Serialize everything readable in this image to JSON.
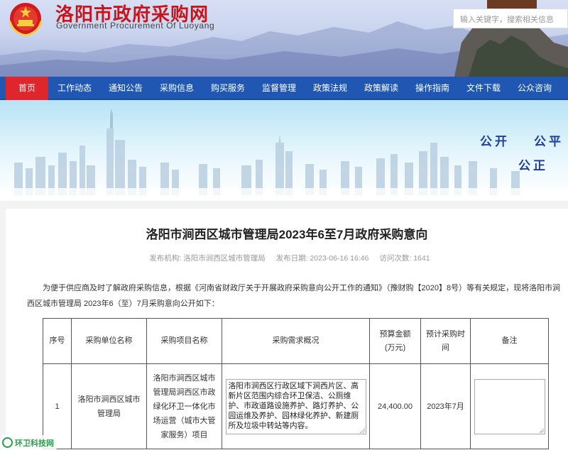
{
  "header": {
    "title": "洛阳市政府采购网",
    "subtitle": "Government Procurement Of Luoyang",
    "search_placeholder": "输入关键字，搜索相关信息"
  },
  "nav": {
    "items": [
      {
        "label": "首页",
        "active": true
      },
      {
        "label": "工作动态"
      },
      {
        "label": "通知公告"
      },
      {
        "label": "采购信息"
      },
      {
        "label": "购买服务"
      },
      {
        "label": "监督管理"
      },
      {
        "label": "政策法规"
      },
      {
        "label": "政策解读"
      },
      {
        "label": "操作指南"
      },
      {
        "label": "文件下载"
      },
      {
        "label": "公众咨询"
      }
    ]
  },
  "banner": {
    "slogan1": "公开",
    "slogan2": "公平",
    "slogan3": "公正"
  },
  "article": {
    "title": "洛阳市涧西区城市管理局2023年6至7月政府采购意向",
    "publisher_label": "发布机构:",
    "publisher": "洛阳市涧西区城市管理局",
    "date_label": "发布日期:",
    "date": "2023-06-16 16:46",
    "visits_label": "访问次数:",
    "visits": "1641",
    "intro_line1": "为便于供应商及时了解政府采购信息，根据《河南省财政厅关于开展政府采购意向公开工作的通知》（豫财购【2020】8号）等有关规定，现将洛阳市涧",
    "intro_line2": "西区城市管理局 2023年6（至）7月采购意向公开如下："
  },
  "table": {
    "headers": {
      "seq": "序号",
      "unit": "采购单位名称",
      "project": "采购项目名称",
      "overview": "采购需求概况",
      "budget_line1": "预算金额",
      "budget_line2": "(万元)",
      "time_line1": "预计采购时",
      "time_line2": "间",
      "remark": "备注"
    },
    "rows": [
      {
        "seq": "1",
        "unit_line1": "洛阳市涧西区城市",
        "unit_line2": "管理局",
        "project_lines": [
          "洛阳市涧西区城市",
          "管理局涧西区市政",
          "绿化环卫一体化市",
          "场运营（城市大管",
          "家服务）项目"
        ],
        "overview": "洛阳市涧西区行政区域下涧西片区、高新片区范围内综合环卫保洁、公厕维护、市政道路设施养护、路灯养护、公园运维及养护、园林绿化养护、新建厕所及垃圾中转站等内容。",
        "budget": "24,400.00",
        "time": "2023年7月",
        "remark": ""
      }
    ]
  },
  "watermark": {
    "text": "环卫科技网"
  },
  "colors": {
    "nav_bg": "#1f57b3",
    "nav_active": "#e0262d",
    "title_red": "#c4161c",
    "slogan_blue": "#1f3f9e"
  }
}
